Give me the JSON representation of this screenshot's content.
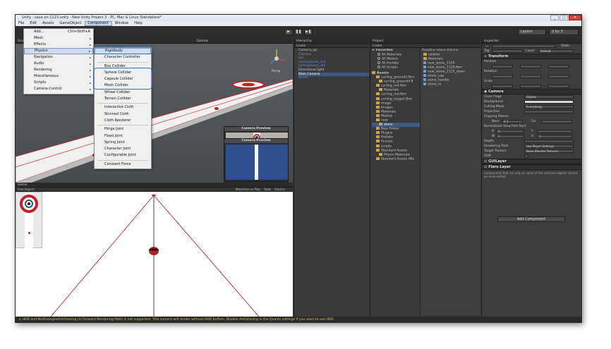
{
  "window": {
    "title": "Unity - save on 1123.unity - New Unity Project 3 - PC, Mac & Linux Standalone*",
    "minimize": "_",
    "maximize": "□",
    "close": "✕"
  },
  "menubar": {
    "items": [
      "File",
      "Edit",
      "Assets",
      "GameObject",
      "Component",
      "Window",
      "Help"
    ],
    "active": "Component"
  },
  "toolbar": {
    "play": "▶",
    "pause": "❚❚",
    "step": "▶❚",
    "layers": "Layers",
    "layout": "2 by 3"
  },
  "component_menu": {
    "items": [
      {
        "label": "Add...",
        "shortcut": "Ctrl+Shift+A",
        "arrow": false
      },
      {
        "label": "Mesh",
        "arrow": true
      },
      {
        "label": "Effects",
        "arrow": true
      },
      {
        "label": "Physics",
        "arrow": true
      },
      {
        "label": "Navigation",
        "arrow": true
      },
      {
        "label": "Audio",
        "arrow": true
      },
      {
        "label": "Rendering",
        "arrow": true
      },
      {
        "label": "Miscellaneous",
        "arrow": true
      },
      {
        "label": "Scripts",
        "arrow": true
      },
      {
        "label": "Camera-Control",
        "arrow": true
      }
    ],
    "highlighted": "Physics",
    "arrow_glyph": "▸"
  },
  "physics_submenu": {
    "groups": [
      [
        "Rigidbody",
        "Character Controller"
      ],
      [
        "Box Collider",
        "Sphere Collider",
        "Capsule Collider",
        "Mesh Collider",
        "Wheel Collider",
        "Terrain Collider"
      ],
      [
        "Interactive Cloth",
        "Skinned Cloth",
        "Cloth Renderer"
      ],
      [
        "Hinge Joint",
        "Fixed Joint",
        "Spring Joint",
        "Character Joint",
        "Configurable Joint"
      ],
      [
        "Constant Force"
      ]
    ],
    "highlighted": "Rigidbody"
  },
  "scene": {
    "tab": "Scene",
    "gizmos": "Gizmos",
    "persp": "Persp",
    "camera_preview_title": "Camera Preview"
  },
  "game": {
    "tab": "Game",
    "aspect": "Free Aspect",
    "maximize": "Maximize on Play",
    "stats": "Stats",
    "gizmos": "Gizmos"
  },
  "hierarchy": {
    "tab": "Hierarchy",
    "create": "Create",
    "items": [
      {
        "label": "Camera_up",
        "style": "normal"
      },
      {
        "label": "Capsule",
        "style": "normal"
      },
      {
        "label": "ion",
        "style": "normal"
      },
      {
        "label": "curlingstone_red",
        "style": "blue"
      },
      {
        "label": "curlingstone_red",
        "style": "blue"
      },
      {
        "label": "Directional light",
        "style": "normal"
      },
      {
        "label": "Main Camera",
        "style": "selected"
      },
      {
        "label": "Sheet",
        "style": "blue"
      }
    ]
  },
  "project": {
    "tab": "Project",
    "create": "Create",
    "breadcrumb": "Assets ▸ new ▸ stone ▸",
    "favorites_label": "Favorites",
    "favorites": [
      "All Materials",
      "All Models",
      "All Prefabs",
      "All Scripts"
    ],
    "assets_label": "Assets",
    "tree": [
      "curling_ground3.fbm",
      "curling_ground4.fl",
      "curling_red.fbm",
      "Materials",
      "curling_red.fbm",
      "curling_stage2.fbm",
      "image",
      "Images",
      "Materials",
      "Models",
      "new",
      "stone",
      "New Folder",
      "Plugins",
      "Prefabs",
      "Scenes",
      "scripts",
      "Standard Assets",
      "Physic Materials",
      "Standard Assets (Mo"
    ],
    "files": [
      "collider",
      "Materials",
      "new_stone_1120",
      "new_stone_1120.fbm",
      "new_stone_1120_dawn",
      "stone_cap",
      "stone_handle",
      "stone_m"
    ]
  },
  "inspector": {
    "tab": "Inspector",
    "tag_label": "Tag",
    "layer_label": "Layer",
    "layer_value": "Default",
    "static_label": "Static",
    "transform": {
      "title": "Transform",
      "rows": [
        {
          "label": "Position",
          "x": "",
          "y": "",
          "z": ""
        },
        {
          "label": "Rotation",
          "x": "",
          "y": "",
          "z": ""
        },
        {
          "label": "Scale",
          "x": "",
          "y": "",
          "z": ""
        }
      ]
    },
    "camera": {
      "title": "Camera",
      "fields": [
        {
          "label": "Clear Flags",
          "value": "Skybox"
        },
        {
          "label": "Background",
          "value": ""
        },
        {
          "label": "Culling Mask",
          "value": "Everything"
        },
        {
          "label": "Projection",
          "value": ""
        },
        {
          "label": "Clipping Planes",
          "value": ""
        },
        {
          "label": "Normalized View Port Rect",
          "value": ""
        },
        {
          "label": "Depth",
          "value": ""
        },
        {
          "label": "Rendering Path",
          "value": "Use Player Settings"
        },
        {
          "label": "Target Texture",
          "value": "None (Render Texture)"
        },
        {
          "label": "HDR",
          "value": ""
        }
      ],
      "near_label": "Near",
      "near_value": "0.3",
      "far_label": "Far",
      "x_label": "X",
      "x_value": "0",
      "y_label": "Y",
      "w_label": "W",
      "w_value": "1",
      "h_label": "H",
      "h_value": "1"
    },
    "gui_layer": "GUILayer",
    "flare_layer": "Flare Layer",
    "notice": "Components that are only on some of the selected objects cannot be multi-edited.",
    "add_component": "Add Component"
  },
  "status": {
    "message": "HDR and MultisampleAntiAliasing (in Forward Rendering Path) is not supported. This camera will render without HDR buffers. Disable Antialiasing in the Quality settings if you want to use HDR."
  },
  "colors": {
    "accent_blue": "#5a8fe0",
    "selection": "#3d5a87",
    "target_red": "#c0232b",
    "preview_blue": "#2f4f8f",
    "warning": "#e2c25b",
    "highlight_ring": "#2f6fb0"
  }
}
